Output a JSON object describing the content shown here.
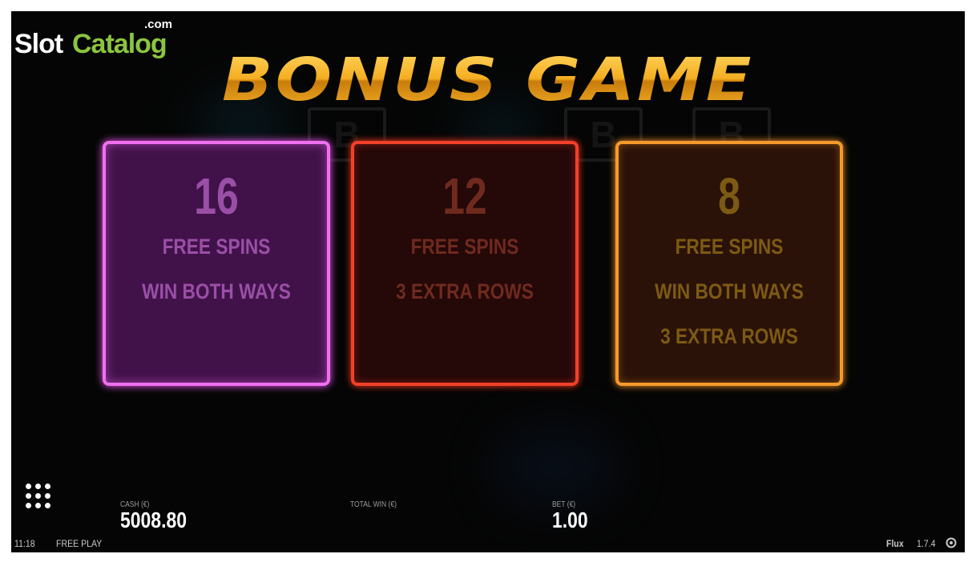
{
  "watermark": {
    "slot": "Slot",
    "catalog": "Catalog",
    "com": ".com"
  },
  "title": "BONUS GAME",
  "bonus_options": [
    {
      "count": "16",
      "line1": "FREE SPINS",
      "line2": "WIN BOTH WAYS",
      "line3": ""
    },
    {
      "count": "12",
      "line1": "FREE SPINS",
      "line2": "3 EXTRA ROWS",
      "line3": ""
    },
    {
      "count": "8",
      "line1": "FREE SPINS",
      "line2": "WIN BOTH WAYS",
      "line3": "3 EXTRA ROWS"
    }
  ],
  "stats": {
    "cash_label": "CASH (€)",
    "cash_value": "5008.80",
    "total_win_label": "TOTAL WIN (€)",
    "total_win_value": "",
    "bet_label": "BET (€)",
    "bet_value": "1.00"
  },
  "footer": {
    "time": "11:18",
    "mode": "FREE PLAY",
    "game_name": "Flux",
    "version": "1.7.4"
  },
  "icons": {
    "menu": "grid-menu-icon",
    "settings": "settings-icon"
  },
  "colors": {
    "accent_gold": "#f4ad20",
    "card_pink": "#f070f0",
    "card_red": "#f2402a",
    "card_orange": "#f49a2c"
  }
}
